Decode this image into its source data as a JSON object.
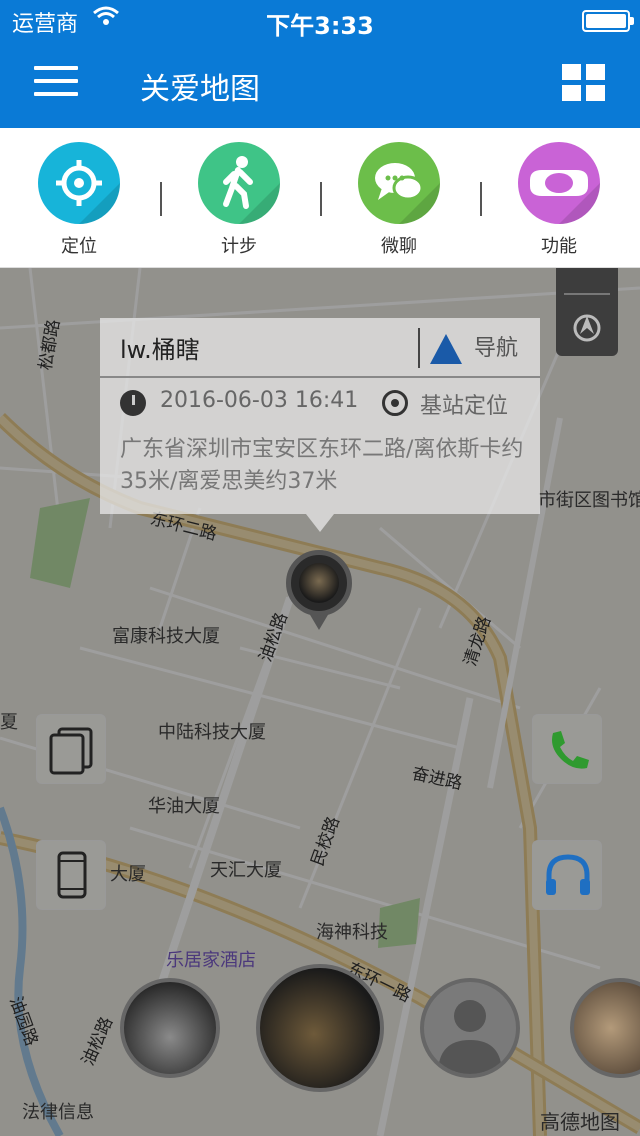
{
  "statusbar": {
    "carrier": "运营商",
    "time": "下午3:33"
  },
  "header": {
    "title": "关爱地图"
  },
  "shortcuts": [
    {
      "label": "定位",
      "color": "#17b4d9",
      "icon": "location-target-icon"
    },
    {
      "label": "计步",
      "color": "#3fc487",
      "icon": "walking-person-icon"
    },
    {
      "label": "微聊",
      "color": "#6cbe4a",
      "icon": "chat-bubble-icon"
    },
    {
      "label": "功能",
      "color": "#c963d6",
      "icon": "watch-icon"
    }
  ],
  "popup": {
    "name": "lw.桶瞎",
    "nav_label": "导航",
    "time": "2016-06-03 16:41",
    "loc_type": "基站定位",
    "address": "广东省深圳市宝安区东环二路/离依斯卡约35米/离爱思美约37米"
  },
  "map": {
    "labels": {
      "fukang": "富康科技大厦",
      "zhonglu": "中陆科技大厦",
      "huayou": "华油大厦",
      "tianhui": "天汇大厦",
      "haishen": "海神科技",
      "lejujia": "乐居家酒店",
      "library": "市街区图书馆",
      "dasha": "大厦",
      "falv": "法律信息",
      "xia": "夏",
      "amap": "高德地图"
    },
    "roads": {
      "donghuan2": "东环二路",
      "donghuan1": "东环一路",
      "yousong": "油松路",
      "yousong2": "油松路",
      "songdu": "松都路",
      "qijin": "奋进路",
      "minxiao": "民校路",
      "qinglong": "清龙路",
      "youyuan": "油园路"
    }
  },
  "colors": {
    "brand": "#0a7ad6",
    "phone": "#2f9a2f",
    "headset": "#1f6fc2"
  }
}
